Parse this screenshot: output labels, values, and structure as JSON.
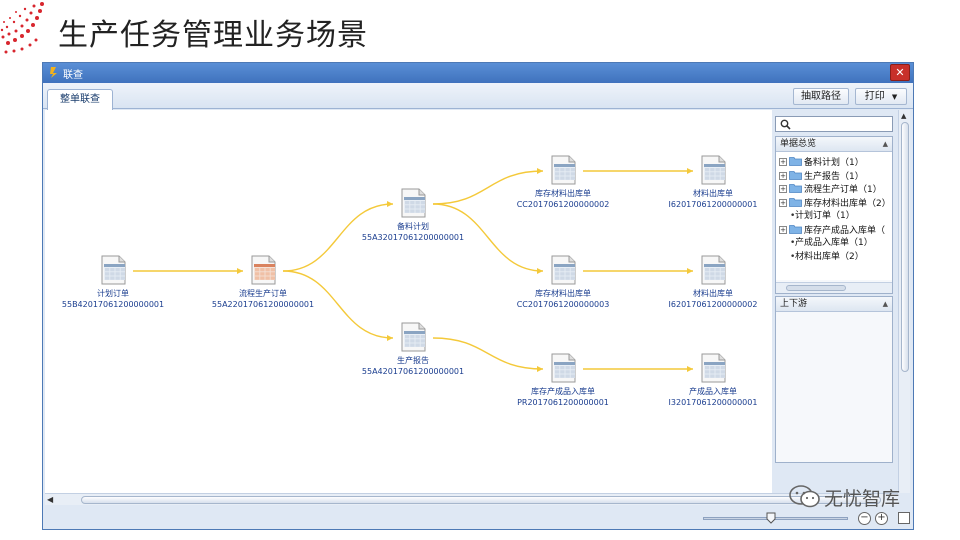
{
  "slide": {
    "title": "生产任务管理业务场景"
  },
  "window": {
    "title": "联查",
    "close_label": "✕",
    "tab_label": "整单联查",
    "btn_extract": "抽取路径",
    "btn_print": "打印",
    "print_caret": "▼"
  },
  "flow": {
    "nodes": [
      {
        "name": "计划订单",
        "code": "55B42017061200000001",
        "type": "plain"
      },
      {
        "name": "流程生产订单",
        "code": "55A22017061200000001",
        "type": "red"
      },
      {
        "name": "备料计划",
        "code": "55A32017061200000001",
        "type": "plain"
      },
      {
        "name": "生产报告",
        "code": "55A42017061200000001",
        "type": "plain"
      },
      {
        "name": "库存材料出库单",
        "code": "CC2017061200000002",
        "type": "plain"
      },
      {
        "name": "库存材料出库单",
        "code": "CC2017061200000003",
        "type": "plain"
      },
      {
        "name": "库存产成品入库单",
        "code": "PR2017061200000001",
        "type": "plain"
      },
      {
        "name": "材料出库单",
        "code": "I62017061200000001",
        "type": "plain"
      },
      {
        "name": "材料出库单",
        "code": "I62017061200000002",
        "type": "plain"
      },
      {
        "name": "产成品入库单",
        "code": "I32017061200000001",
        "type": "plain"
      }
    ]
  },
  "sidebar": {
    "search_placeholder": "",
    "summary_title": "单据总览",
    "stream_title": "上下游",
    "tree": [
      {
        "label": "备料计划（1）",
        "kind": "folder"
      },
      {
        "label": "生产报告（1）",
        "kind": "folder"
      },
      {
        "label": "流程生产订单（1）",
        "kind": "folder"
      },
      {
        "label": "库存材料出库单（2）",
        "kind": "folder"
      },
      {
        "label": "计划订单（1）",
        "kind": "leaf"
      },
      {
        "label": "库存产成品入库单（",
        "kind": "folder"
      },
      {
        "label": "产成品入库单（1）",
        "kind": "leaf"
      },
      {
        "label": "材料出库单（2）",
        "kind": "leaf"
      }
    ]
  },
  "watermark": {
    "text": "无忧智库"
  },
  "colors": {
    "link": "#f4c93a",
    "titlebar": "#4a80c9",
    "node_text": "#1a3d8f"
  }
}
